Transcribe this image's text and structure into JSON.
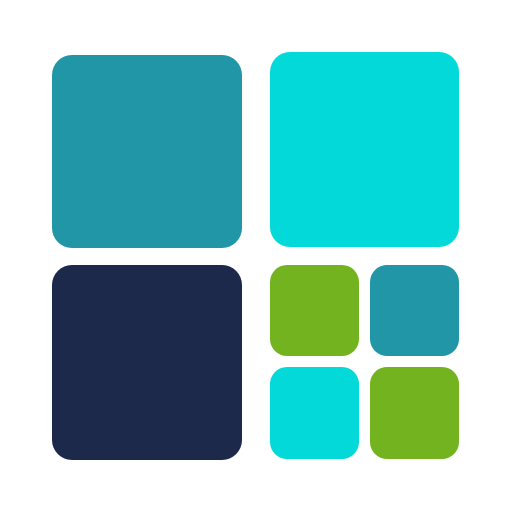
{
  "logo": {
    "icon": "tile-grid-logo-icon",
    "tiles": [
      {
        "id": "tile-tl",
        "name": "tile-large-top-left",
        "color": "#2096A6"
      },
      {
        "id": "tile-tr",
        "name": "tile-large-top-right",
        "color": "#04D9D9"
      },
      {
        "id": "tile-bl",
        "name": "tile-large-bottom-left",
        "color": "#1C294A"
      },
      {
        "id": "tile-s1",
        "name": "tile-small-1",
        "color": "#73B31F"
      },
      {
        "id": "tile-s2",
        "name": "tile-small-2",
        "color": "#2096A6"
      },
      {
        "id": "tile-s3",
        "name": "tile-small-3",
        "color": "#04D9D9"
      },
      {
        "id": "tile-s4",
        "name": "tile-small-4",
        "color": "#73B31F"
      }
    ]
  }
}
